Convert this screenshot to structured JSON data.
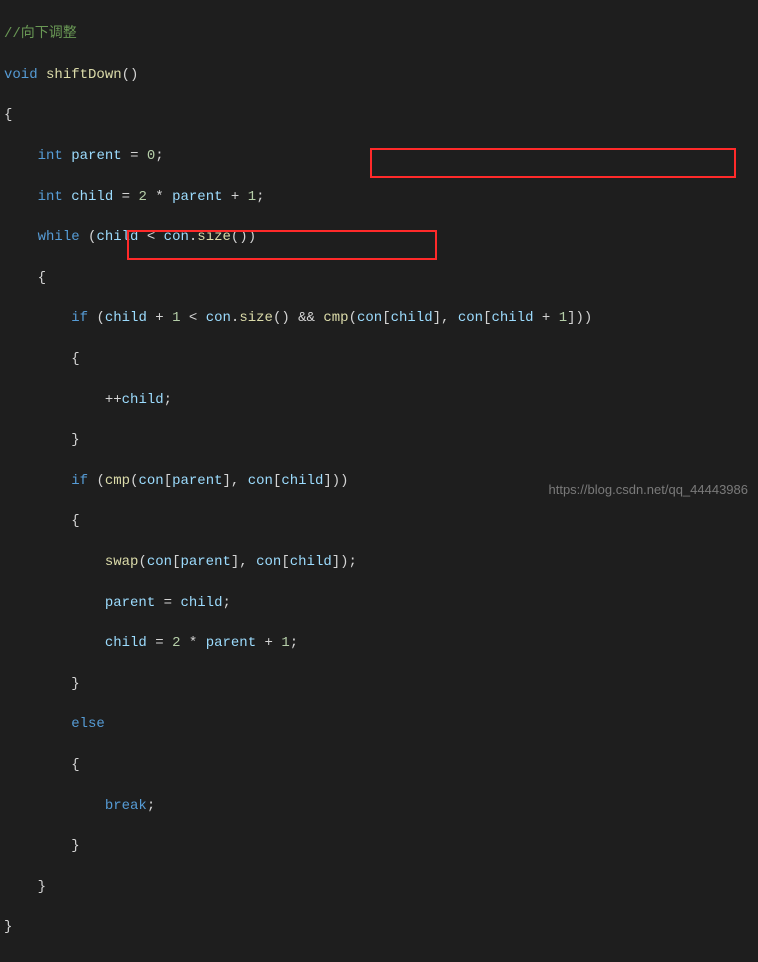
{
  "code": {
    "comment": "//向下调整",
    "kw_void": "void",
    "fn_name": "shiftDown",
    "kw_int": "int",
    "id_parent": "parent",
    "id_child": "child",
    "kw_while": "while",
    "kw_if": "if",
    "kw_else": "else",
    "kw_break": "break",
    "id_con": "con",
    "fn_size": "size",
    "fn_cmp": "cmp",
    "fn_swap": "swap",
    "num_0": "0",
    "num_1": "1",
    "num_2": "2",
    "op_star": "*",
    "op_plus": "+",
    "op_lt": "<",
    "op_and": "&&",
    "op_eq": "=",
    "op_inc": "++"
  },
  "watermark": "https://blog.csdn.net/qq_44443986"
}
